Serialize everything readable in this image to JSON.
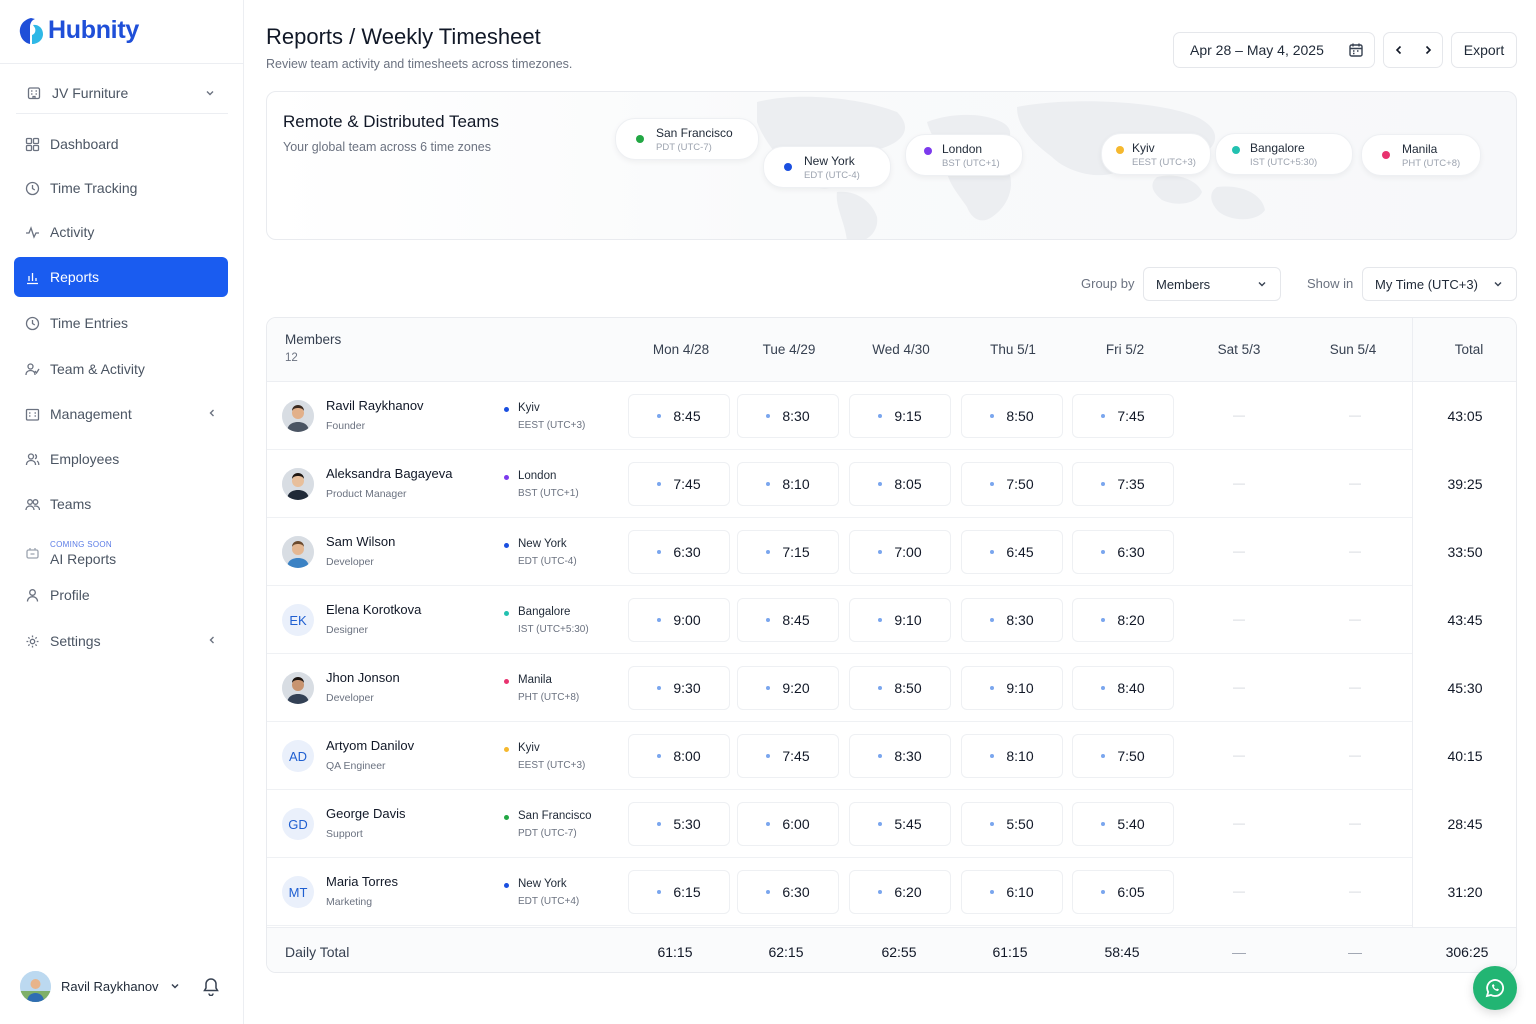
{
  "brand": {
    "name": "Hubnity"
  },
  "org": {
    "name": "JV Furniture"
  },
  "nav": [
    {
      "label": "Dashboard",
      "icon": "grid-icon"
    },
    {
      "label": "Time Tracking",
      "icon": "clock-icon"
    },
    {
      "label": "Activity",
      "icon": "pulse-icon"
    },
    {
      "label": "Reports",
      "icon": "bar-chart-icon",
      "active": true
    },
    {
      "label": "Time Entries",
      "icon": "clock-icon"
    },
    {
      "label": "Team & Activity",
      "icon": "user-activity-icon"
    },
    {
      "label": "Management",
      "icon": "building-icon"
    },
    {
      "label": "Employees",
      "icon": "users-icon"
    },
    {
      "label": "Teams",
      "icon": "team-icon"
    },
    {
      "label": "AI Reports",
      "badge": "COMING SOON",
      "icon": "ai-icon"
    },
    {
      "label": "Profile",
      "icon": "user-icon"
    },
    {
      "label": "Settings",
      "icon": "gear-icon"
    }
  ],
  "user": {
    "name": "Ravil Raykhanov"
  },
  "header": {
    "title": "Reports / Weekly Timesheet",
    "subtitle": "Review team activity and timesheets across timezones.",
    "date_range": "Apr 28 – May 4, 2025",
    "export_label": "Export"
  },
  "remote": {
    "title": "Remote & Distributed Teams",
    "subtitle": "Your global team across 6 time zones",
    "zones": [
      {
        "city": "San Francisco",
        "zone": "PDT (UTC-7)",
        "color": "#22a744"
      },
      {
        "city": "New York",
        "zone": "EDT (UTC-4)",
        "color": "#1a4fe0"
      },
      {
        "city": "London",
        "zone": "BST (UTC+1)",
        "color": "#7c3aed"
      },
      {
        "city": "Kyiv",
        "zone": "EEST (UTC+3)",
        "color": "#f5b82e"
      },
      {
        "city": "Bangalore",
        "zone": "IST (UTC+5:30)",
        "color": "#22c1b0"
      },
      {
        "city": "Manila",
        "zone": "PHT (UTC+8)",
        "color": "#e8336f"
      }
    ]
  },
  "controls": {
    "group_by_label": "Group by",
    "group_by_value": "Members",
    "show_in_label": "Show in",
    "show_in_value": "My Time (UTC+3)"
  },
  "table": {
    "members_label": "Members",
    "members_count": "12",
    "days": [
      "Mon 4/28",
      "Tue 4/29",
      "Wed 4/30",
      "Thu 5/1",
      "Fri 5/2",
      "Sat 5/3",
      "Sun 5/4"
    ],
    "total_label": "Total",
    "empty": "—",
    "rows": [
      {
        "name": "Ravil Raykhanov",
        "role": "Founder",
        "initials": "",
        "city": "Kyiv",
        "zone": "EEST (UTC+3)",
        "color": "#1a4fe0",
        "hours": [
          "8:45",
          "8:30",
          "9:15",
          "8:50",
          "7:45"
        ],
        "total": "43:05"
      },
      {
        "name": "Aleksandra Bagayeva",
        "role": "Product Manager",
        "initials": "",
        "city": "London",
        "zone": "BST (UTC+1)",
        "color": "#7c3aed",
        "hours": [
          "7:45",
          "8:10",
          "8:05",
          "7:50",
          "7:35"
        ],
        "total": "39:25"
      },
      {
        "name": "Sam Wilson",
        "role": "Developer",
        "initials": "",
        "city": "New York",
        "zone": "EDT (UTC-4)",
        "color": "#1a4fe0",
        "hours": [
          "6:30",
          "7:15",
          "7:00",
          "6:45",
          "6:30"
        ],
        "total": "33:50"
      },
      {
        "name": "Elena Korotkova",
        "role": "Designer",
        "initials": "EK",
        "city": "Bangalore",
        "zone": "IST (UTC+5:30)",
        "color": "#22c1b0",
        "hours": [
          "9:00",
          "8:45",
          "9:10",
          "8:30",
          "8:20"
        ],
        "total": "43:45"
      },
      {
        "name": "Jhon Jonson",
        "role": "Developer",
        "initials": "",
        "city": "Manila",
        "zone": "PHT (UTC+8)",
        "color": "#e8336f",
        "hours": [
          "9:30",
          "9:20",
          "8:50",
          "9:10",
          "8:40"
        ],
        "total": "45:30"
      },
      {
        "name": "Artyom Danilov",
        "role": "QA Engineer",
        "initials": "AD",
        "city": "Kyiv",
        "zone": "EEST (UTC+3)",
        "color": "#f5b82e",
        "hours": [
          "8:00",
          "7:45",
          "8:30",
          "8:10",
          "7:50"
        ],
        "total": "40:15"
      },
      {
        "name": "George Davis",
        "role": "Support",
        "initials": "GD",
        "city": "San Francisco",
        "zone": "PDT (UTC-7)",
        "color": "#22a744",
        "hours": [
          "5:30",
          "6:00",
          "5:45",
          "5:50",
          "5:40"
        ],
        "total": "28:45"
      },
      {
        "name": "Maria Torres",
        "role": "Marketing",
        "initials": "MT",
        "city": "New York",
        "zone": "EDT (UTC+4)",
        "color": "#1a4fe0",
        "hours": [
          "6:15",
          "6:30",
          "6:20",
          "6:10",
          "6:05"
        ],
        "total": "31:20"
      }
    ],
    "footer": {
      "label": "Daily Total",
      "values": [
        "61:15",
        "62:15",
        "62:55",
        "61:15",
        "58:45",
        "—",
        "—"
      ],
      "total": "306:25"
    }
  },
  "colors": {
    "accent": "#1a5cf0",
    "whatsapp": "#22b573"
  }
}
